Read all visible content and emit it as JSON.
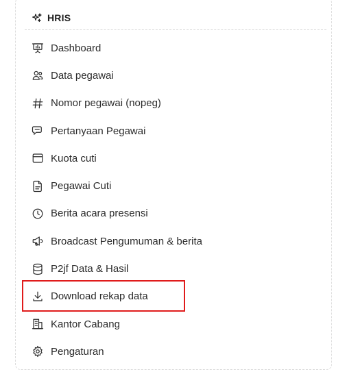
{
  "header": {
    "title": "HRIS",
    "icon": "sparkles-icon"
  },
  "menu": {
    "items": [
      {
        "label": "Dashboard",
        "icon": "presentation-chart-icon"
      },
      {
        "label": "Data pegawai",
        "icon": "users-icon"
      },
      {
        "label": "Nomor pegawai (nopeg)",
        "icon": "hash-icon"
      },
      {
        "label": "Pertanyaan Pegawai",
        "icon": "chat-bubbles-icon"
      },
      {
        "label": "Kuota cuti",
        "icon": "calendar-window-icon"
      },
      {
        "label": "Pegawai Cuti",
        "icon": "document-icon"
      },
      {
        "label": "Berita acara presensi",
        "icon": "clock-icon"
      },
      {
        "label": "Broadcast Pengumuman & berita",
        "icon": "megaphone-icon"
      },
      {
        "label": "P2jf Data & Hasil",
        "icon": "database-icon"
      },
      {
        "label": "Download rekap data",
        "icon": "download-icon",
        "highlighted": true
      },
      {
        "label": "Kantor Cabang",
        "icon": "building-icon"
      },
      {
        "label": "Pengaturan",
        "icon": "gear-icon"
      }
    ]
  },
  "colors": {
    "highlight_border": "#e01b1b",
    "text": "#2b2b2b"
  }
}
